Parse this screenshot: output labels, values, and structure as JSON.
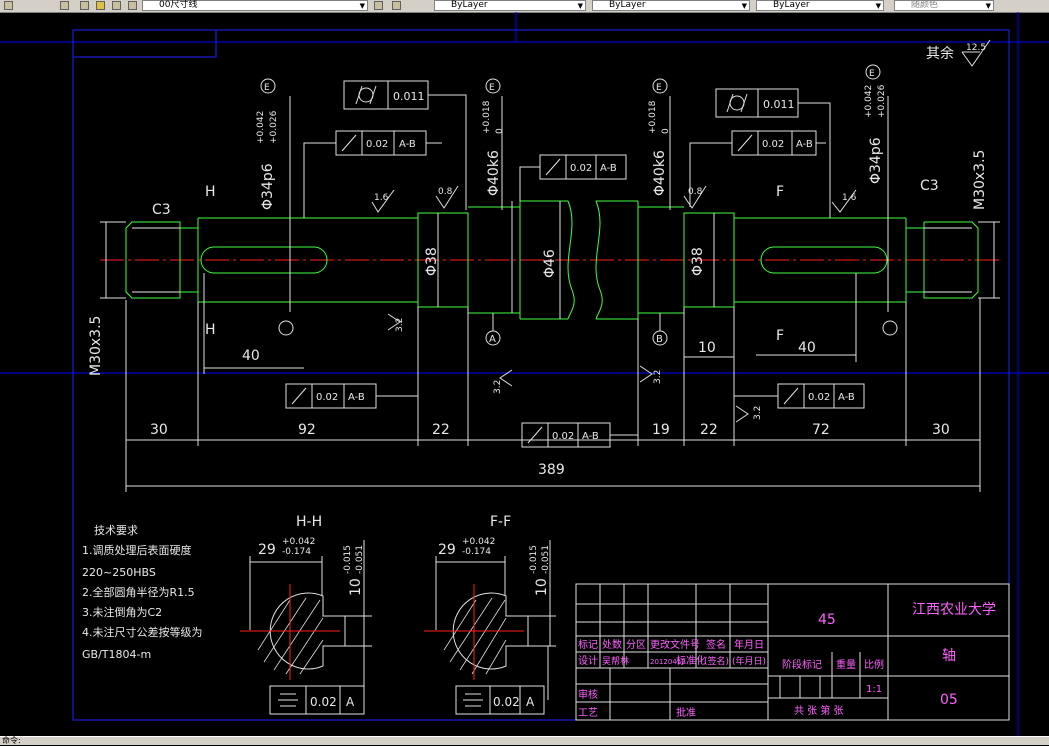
{
  "toolbar": {
    "layer_value": "00尺寸线",
    "color_value": "ByLayer",
    "linetype_value": "ByLayer",
    "lineweight_value": "ByLayer",
    "plotstyle_value": "随颜色"
  },
  "status": {
    "command_text": "命令:"
  },
  "drawing": {
    "roughness_note": "其余",
    "roughness_value": "12.5",
    "d_left_bearing": "Φ34p6",
    "tol_p6_upper": "+0.042",
    "tol_p6_lower": "+0.026",
    "envelope": "E",
    "d_k6": "Φ40k6",
    "tol_k6_upper": "+0.018",
    "tol_k6_lower": "0",
    "d_38": "Φ38",
    "d_46": "Φ46",
    "thread_left": "M30x3.5",
    "thread_right": "M30x3.5",
    "chamfer": "C3",
    "cyl_tol": "0.011",
    "runout_tol": "0.02",
    "datum_ab": "A-B",
    "datum_a": "A",
    "datum_b": "B",
    "rough_16": "1.6",
    "rough_08": "0.8",
    "rough_32": "3.2",
    "sec_h": "H",
    "sec_f": "F",
    "dims": {
      "d30a": "30",
      "d92": "92",
      "d22a": "22",
      "d19": "19",
      "d22b": "22",
      "d72": "72",
      "d30b": "30",
      "total": "389",
      "key40a": "40",
      "key40b": "40",
      "d10": "10"
    },
    "section_hh": {
      "title": "H-H",
      "width": "29",
      "w_upper": "+0.042",
      "w_lower": "-0.174",
      "depth": "10",
      "d_upper": "-0.015",
      "d_lower": "-0.051"
    },
    "section_ff": {
      "title": "F-F",
      "width": "29",
      "w_upper": "+0.042",
      "w_lower": "-0.174",
      "depth": "10",
      "d_upper": "-0.015",
      "d_lower": "-0.051"
    },
    "sym_tol": "0.02",
    "sym_symbol": "⌯",
    "tech_req": {
      "title": "技术要求",
      "line1": "1.调质处理后表面硬度",
      "line2": "220~250HBS",
      "line3": "2.全部圆角半径为R1.5",
      "line4": "3.未注倒角为C2",
      "line5": "4.未注尺寸公差按等级为",
      "line6": "GB/T1804-m"
    },
    "title_block": {
      "material": "45",
      "school": "江西农业大学",
      "part_name": "轴",
      "drawing_no": "05",
      "scale": "1:1",
      "h_mark": "标记",
      "h_count": "处数",
      "h_zone": "分区",
      "h_doc": "更改文件号",
      "h_sign": "签名",
      "h_date": "年月日",
      "h_design": "设计",
      "h_designer": "吴帮林",
      "h_date_val": "20120412",
      "h_std": "标准化",
      "h_sign2": "(签名)",
      "h_date2": "(年月日)",
      "h_stage": "阶段标记",
      "h_weight": "重量",
      "h_scale": "比例",
      "h_check": "审核",
      "h_process": "工艺",
      "h_approve": "批准",
      "h_sheets": "共  张  第  张"
    }
  }
}
